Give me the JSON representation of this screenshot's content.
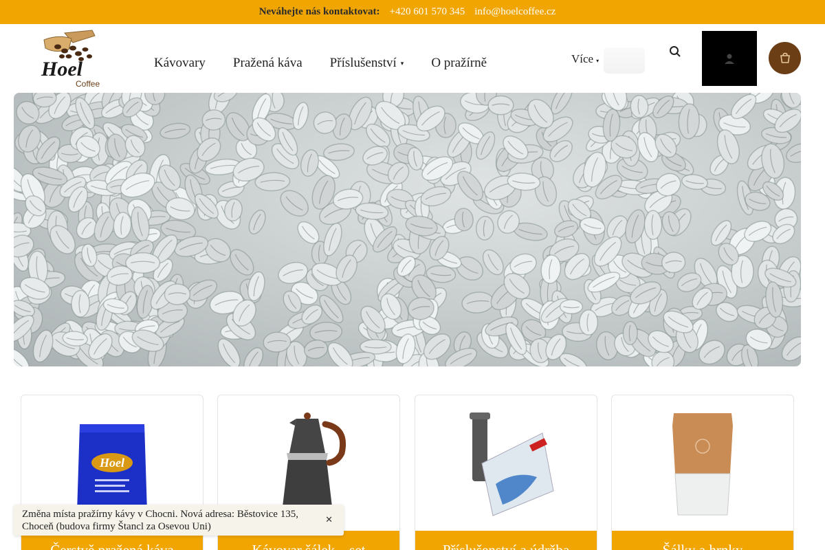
{
  "topbar": {
    "lead": "Neváhejte nás kontaktovat:",
    "phone": "+420 601 570 345",
    "email": "info@hoelcoffee.cz"
  },
  "brand": {
    "name": "Hoel",
    "sub": "Coffee",
    "color": "#f0a500",
    "dark_brown": "#6b3e16"
  },
  "nav": {
    "items": [
      {
        "label": "Kávovary"
      },
      {
        "label": "Pražená káva"
      },
      {
        "label": "Příslušenství",
        "dropdown": true
      },
      {
        "label": "O pražírně"
      }
    ],
    "more_label": "Více"
  },
  "header_icons": {
    "search": "search-icon",
    "user": "user-icon",
    "cart": "cart-icon"
  },
  "cards": [
    {
      "title": "Čerstvě pražená káva",
      "icon": "coffee-bag"
    },
    {
      "title": "Kávovar šálek – set",
      "icon": "moka-pot"
    },
    {
      "title": "Příslušenství a údržba",
      "icon": "water-filter"
    },
    {
      "title": "Šálky a hrnky",
      "icon": "reusable-cup"
    }
  ],
  "toast": {
    "text": "Změna místa pražírny kávy v Chocni. Nová adresa: Běstovice 135, Choceň (budova firmy Štancl za Osevou Uni)",
    "close": "close-icon"
  }
}
